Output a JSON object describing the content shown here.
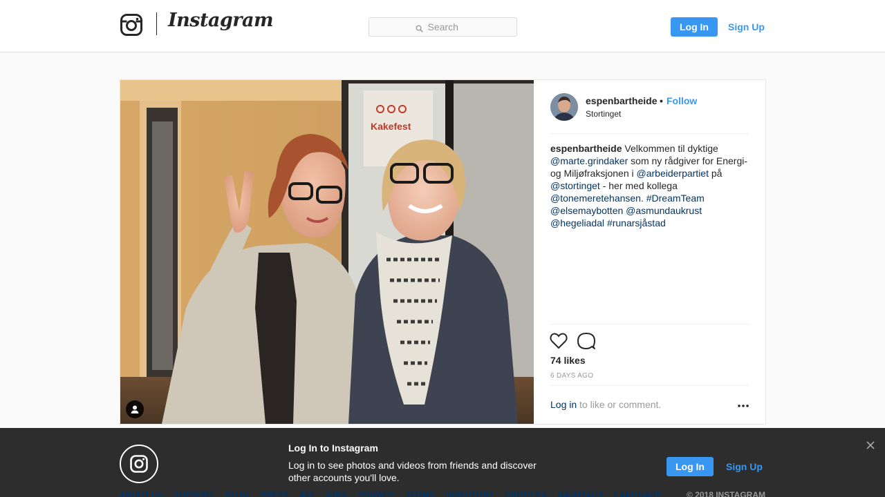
{
  "header": {
    "brand": "Instagram",
    "search_placeholder": "Search",
    "login_label": "Log In",
    "signup_label": "Sign Up"
  },
  "post": {
    "username": "espenbartheide",
    "separator": "•",
    "follow_label": "Follow",
    "location": "Stortinget",
    "caption": {
      "author": "espenbartheide",
      "segments": [
        {
          "type": "text",
          "text": " Velkommen til dyktige "
        },
        {
          "type": "link",
          "text": "@marte.grindaker"
        },
        {
          "type": "text",
          "text": " som ny rådgiver for Energi- og Miljøfraksjonen i "
        },
        {
          "type": "link",
          "text": "@arbeiderpartiet"
        },
        {
          "type": "text",
          "text": " på "
        },
        {
          "type": "link",
          "text": "@stortinget"
        },
        {
          "type": "text",
          "text": " - her med kollega "
        },
        {
          "type": "link",
          "text": "@tonemeretehansen"
        },
        {
          "type": "text",
          "text": ". "
        },
        {
          "type": "link",
          "text": "#DreamTeam"
        },
        {
          "type": "text",
          "text": " "
        },
        {
          "type": "link",
          "text": "@elsemaybotten"
        },
        {
          "type": "text",
          "text": " "
        },
        {
          "type": "link",
          "text": "@asmundaukrust"
        },
        {
          "type": "text",
          "text": " "
        },
        {
          "type": "link",
          "text": "@hegeliadal"
        },
        {
          "type": "text",
          "text": " "
        },
        {
          "type": "link",
          "text": "#runarsjåstad"
        }
      ]
    },
    "likes": "74 likes",
    "time_ago": "6 DAYS AGO",
    "login_link": "Log in",
    "login_suffix": " to like or comment.",
    "poster_text": "Kakefest"
  },
  "banner": {
    "title": "Log In to Instagram",
    "text": "Log in to see photos and videos from friends and discover other accounts you'll love.",
    "login_label": "Log In",
    "signup_label": "Sign Up"
  },
  "footer": {
    "links": [
      "ABOUT US",
      "SUPPORT",
      "BLOG",
      "PRESS",
      "API",
      "JOBS",
      "PRIVACY",
      "TERMS",
      "DIRECTORY",
      "PROFILES",
      "HASHTAGS",
      "LANGUAGE"
    ],
    "copyright": "© 2018 INSTAGRAM"
  },
  "colors": {
    "accent": "#3897f0",
    "link": "#003569",
    "banner_bg": "#262626"
  },
  "icons": [
    "instagram-glyph-icon",
    "search-icon",
    "user-tag-icon",
    "heart-icon",
    "comment-icon",
    "more-options-icon",
    "close-icon"
  ]
}
